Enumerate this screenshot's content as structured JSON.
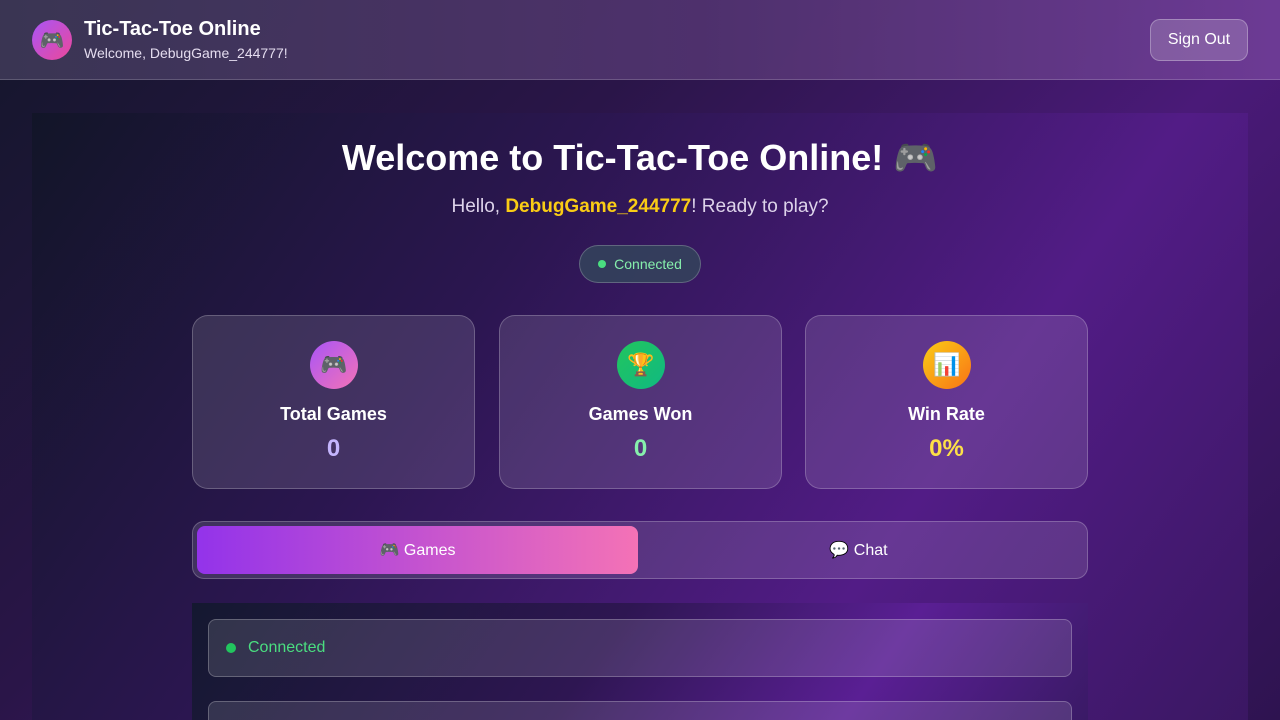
{
  "header": {
    "logo_icon": "🎮",
    "title": "Tic-Tac-Toe Online",
    "subtitle": "Welcome, DebugGame_244777!",
    "signout_label": "Sign Out"
  },
  "hero": {
    "title": "Welcome to Tic-Tac-Toe Online! 🎮",
    "greeting_prefix": "Hello, ",
    "username": "DebugGame_244777",
    "greeting_suffix": "! Ready to play?",
    "connection_status": "Connected"
  },
  "stats": [
    {
      "icon": "🎮",
      "icon_name": "gamepad-icon",
      "label": "Total Games",
      "value": "0",
      "value_color": "#c4b5fd"
    },
    {
      "icon": "🏆",
      "icon_name": "trophy-icon",
      "label": "Games Won",
      "value": "0",
      "value_color": "#86efac"
    },
    {
      "icon": "📊",
      "icon_name": "bar-chart-icon",
      "label": "Win Rate",
      "value": "0%",
      "value_color": "#fde047"
    }
  ],
  "tabs": [
    {
      "label": "🎮 Games",
      "active": true
    },
    {
      "label": "💬 Chat",
      "active": false
    }
  ],
  "content": {
    "status": "Connected"
  },
  "colors": {
    "accent_start": "#9333ea",
    "accent_end": "#f472b6",
    "highlight": "#facc15",
    "online": "#22c55e"
  }
}
